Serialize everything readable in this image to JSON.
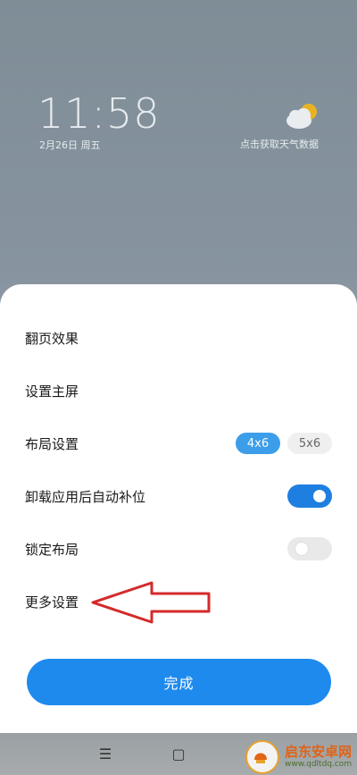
{
  "lockscreen": {
    "time": "11:58",
    "date": "2月26日 周五",
    "weather_prompt": "点击获取天气数据",
    "weather_icon": "partly-cloudy-icon"
  },
  "settings": {
    "items": [
      {
        "label": "翻页效果"
      },
      {
        "label": "设置主屏"
      },
      {
        "label": "布局设置",
        "options": [
          "4x6",
          "5x6"
        ],
        "selected": "4x6"
      },
      {
        "label": "卸载应用后自动补位",
        "toggle": true
      },
      {
        "label": "锁定布局",
        "toggle": false
      },
      {
        "label": "更多设置"
      }
    ],
    "done_label": "完成"
  },
  "navbar": {
    "menu_glyph": "☰",
    "home_glyph": "▢"
  },
  "watermark": {
    "title": "启东安卓网",
    "url": "www.qdltdq.com"
  },
  "colors": {
    "accent": "#1f8aee",
    "chip_active": "#3c9de9",
    "arrow": "#d42a2a"
  }
}
